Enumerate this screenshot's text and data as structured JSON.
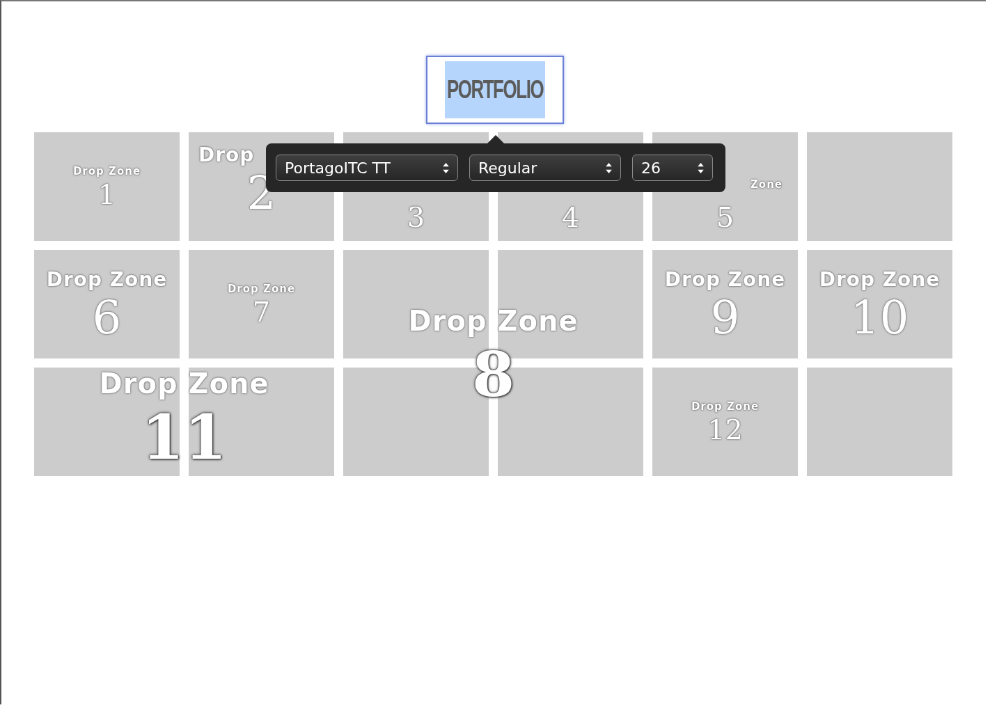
{
  "title_box": {
    "text": "PORTFOLIO",
    "selected": true
  },
  "format_popover": {
    "controls": [
      {
        "kind": "font-family",
        "value": "PortagoITC TT"
      },
      {
        "kind": "font-style",
        "value": "Regular"
      },
      {
        "kind": "font-size",
        "value": "26"
      }
    ]
  },
  "drop_zones": [
    {
      "title": "Drop Zone",
      "number": "1",
      "kind": "small"
    },
    {
      "title": "Drop",
      "number": "2",
      "kind": "large"
    },
    {
      "number": "3",
      "kind": "small"
    },
    {
      "number": "4",
      "kind": "small"
    },
    {
      "title": "Zone",
      "number": "5",
      "kind": "small"
    },
    {
      "title": "Drop Zone",
      "number": "6",
      "kind": "large"
    },
    {
      "title": "Drop Zone",
      "number": "7",
      "kind": "small"
    },
    {
      "title": "Drop Zone",
      "number": "8",
      "kind": "huge"
    },
    {
      "title": "Drop Zone",
      "number": "9",
      "kind": "large"
    },
    {
      "title": "Drop Zone",
      "number": "10",
      "kind": "large"
    },
    {
      "title": "Drop Zone",
      "number": "11",
      "kind": "huge"
    },
    {
      "title": "Drop Zone",
      "number": "12",
      "kind": "small"
    }
  ]
}
